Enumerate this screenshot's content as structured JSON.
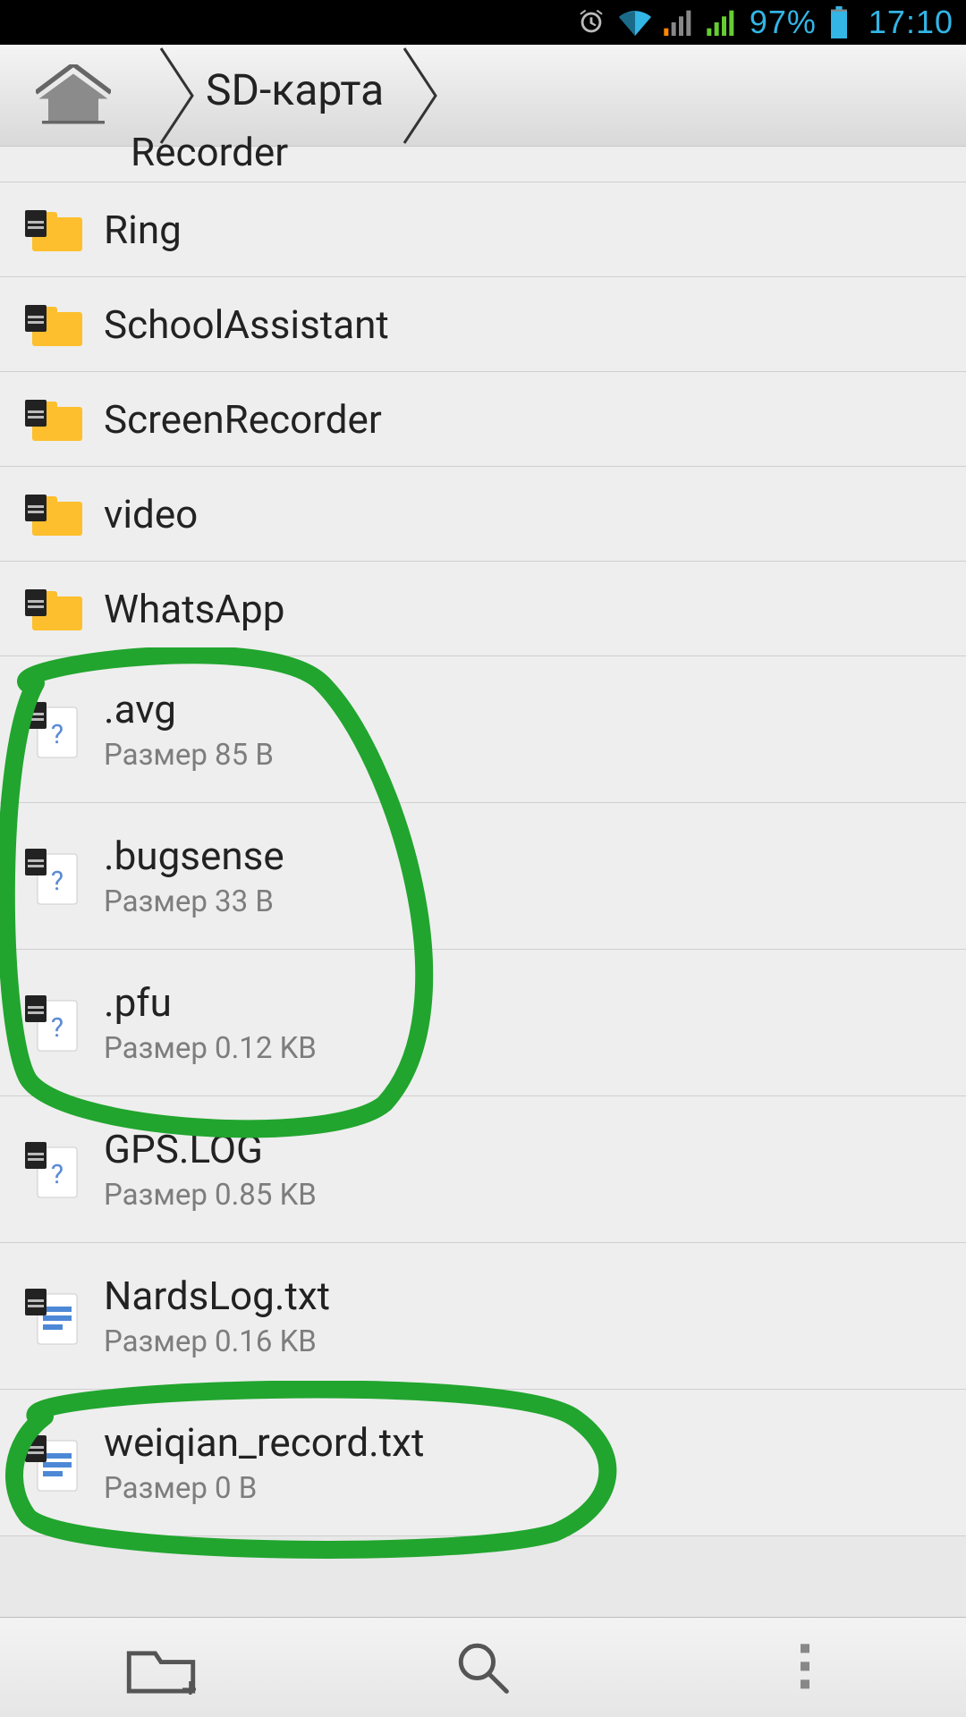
{
  "status_bar": {
    "battery_pct": "97%",
    "time": "17:10"
  },
  "breadcrumb": {
    "current": "SD-карта"
  },
  "size_prefix": "Размер",
  "files": [
    {
      "name": "Recorder",
      "type": "folder"
    },
    {
      "name": "Ring",
      "type": "folder"
    },
    {
      "name": "SchoolAssistant",
      "type": "folder"
    },
    {
      "name": "ScreenRecorder",
      "type": "folder"
    },
    {
      "name": "video",
      "type": "folder"
    },
    {
      "name": "WhatsApp",
      "type": "folder"
    },
    {
      "name": ".avg",
      "type": "file-unknown",
      "size": "85 B"
    },
    {
      "name": ".bugsense",
      "type": "file-unknown",
      "size": "33 B"
    },
    {
      "name": ".pfu",
      "type": "file-unknown",
      "size": "0.12 KB"
    },
    {
      "name": "GPS.LOG",
      "type": "file-unknown",
      "size": "0.85 KB"
    },
    {
      "name": "NardsLog.txt",
      "type": "file-doc",
      "size": "0.16 KB"
    },
    {
      "name": "weiqian_record.txt",
      "type": "file-doc",
      "size": "0 B"
    }
  ]
}
